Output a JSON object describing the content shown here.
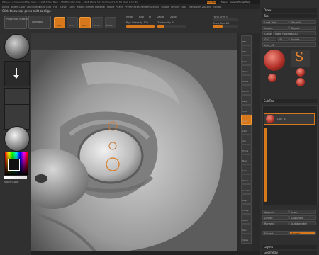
{
  "titlebar": {
    "text": "ZBrush 4.0   Document   Free Mem 1.91GB   Active Mem 1.58GB   Scratch Disk 1.01GB   Ztime 3.01   PolyCount 1.39 Mil   Mesh 1.34 Mil",
    "quicksave": "QuickSave"
  },
  "menu": [
    "Alpha",
    "Brush",
    "Color",
    "Document",
    "Draw",
    "Edit",
    "File",
    "Layer",
    "Light",
    "Macro",
    "Marker",
    "Material",
    "Movie",
    "Picker",
    "Preferences",
    "Render",
    "Stencil",
    "Stroke",
    "Texture",
    "Tool",
    "Transform",
    "Zplugin",
    "Zscript"
  ],
  "status": {
    "text": "Projection Master",
    "hint": "Click to sweep, press shift to align.",
    "menus": "Menus",
    "default_zscript": "DefaultZScript",
    "help": "Help"
  },
  "top_toolbar": {
    "projection_label": "Projection Master",
    "lightbox_label": "LightBox",
    "buttons": [
      "Edit",
      "Draw",
      "Move",
      "Scale",
      "Rotate"
    ],
    "zadd": "Zadd",
    "zsub": "Zsub",
    "focal_shift": "Focal Shift 0",
    "draw_size": "Draw Size 64",
    "z_intensity": "Z Intensity 25",
    "rgb_intensity": "Rgb Intensity 100",
    "mrgb": "Mrgb",
    "rgb": "Rgb",
    "m": "M",
    "z_intensity_level": 0.25,
    "rgb_intensity_level": 1.0
  },
  "left_shelf": {
    "color_label": "SwitchColor",
    "gradient": "Gradient"
  },
  "right_shelf": [
    "BPR",
    "SPix",
    "Scroll",
    "Zoom",
    "Actual",
    "AAHalf",
    "Persp",
    "Floor",
    "Local",
    "LSym",
    "Xyz",
    "Frame",
    "Move",
    "Scale",
    "Rotate",
    "Line Fill",
    "PolyF",
    "Transp",
    "Ghost",
    "Solo",
    "Xpose"
  ],
  "tray": {
    "draw_header": "Draw",
    "tool_header": "Tool",
    "load_tool": "Load Tool",
    "save_as": "Save As",
    "import": "Import",
    "export": "Export",
    "clone": "Clone",
    "make_polymesh": "Make PolyMesh3D",
    "goz": "GoZ",
    "all": "All",
    "visible": "Visible",
    "current_tool": "Lion_42",
    "subtool_header": "SubTool",
    "subtool_item": "Lion_42",
    "append": "Append",
    "insert": "Insert",
    "delete": "Delete",
    "duplicate": "Duplicate",
    "rename": "Rename",
    "autoreorder": "AutoReorder",
    "extract": "Extract",
    "accept": "Accept",
    "layers_header": "Layers",
    "geometry_header": "Geometry",
    "tool_swatches": [
      "Lion_42",
      "SimpleBrush",
      "Sphere3D",
      "Cylinder3D",
      "PolyMesh3D",
      "Lion_42"
    ]
  },
  "colors": {
    "accent": "#d8781d",
    "panel": "#2f2f2f",
    "dark": "#1d1d1d"
  }
}
